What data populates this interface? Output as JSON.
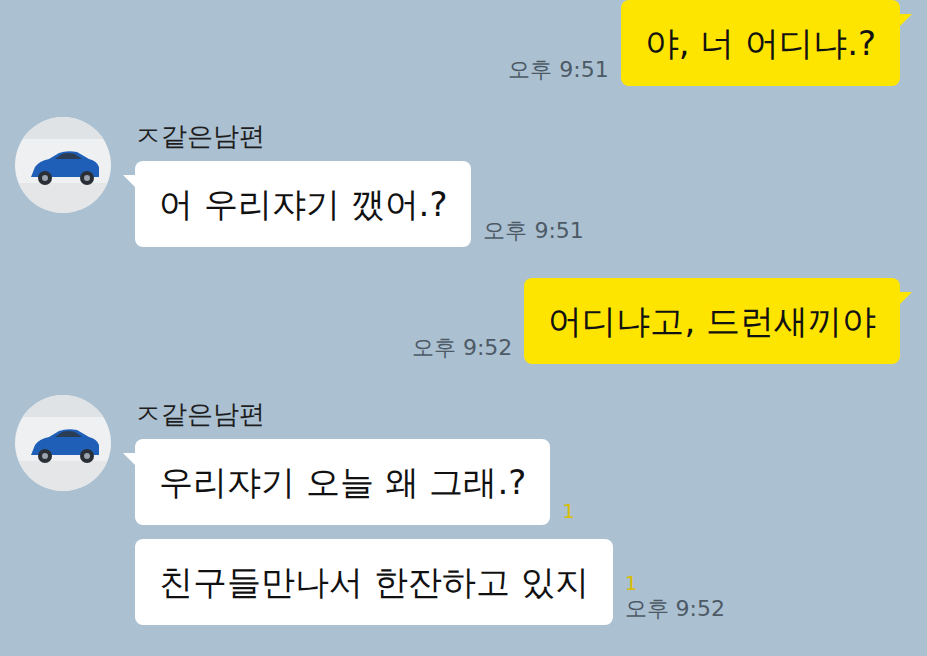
{
  "chat": {
    "groups": [
      {
        "kind": "sent",
        "bubbles": [
          {
            "text": "야, 너 어디냐.?",
            "time": "오후 9:51"
          }
        ]
      },
      {
        "kind": "received",
        "name": "ㅈ같은남편",
        "bubbles": [
          {
            "text": "어 우리쟈기 깼어.?",
            "time": "오후 9:51"
          }
        ]
      },
      {
        "kind": "sent",
        "bubbles": [
          {
            "text": "어디냐고, 드런새끼야",
            "time": "오후 9:52"
          }
        ]
      },
      {
        "kind": "received",
        "name": "ㅈ같은남편",
        "bubbles": [
          {
            "text": "우리쟈기 오늘 왜 그래.?",
            "unread": "1"
          },
          {
            "text": "친구들만나서 한잔하고 있지",
            "unread": "1",
            "time": "오후 9:52"
          }
        ]
      }
    ]
  }
}
